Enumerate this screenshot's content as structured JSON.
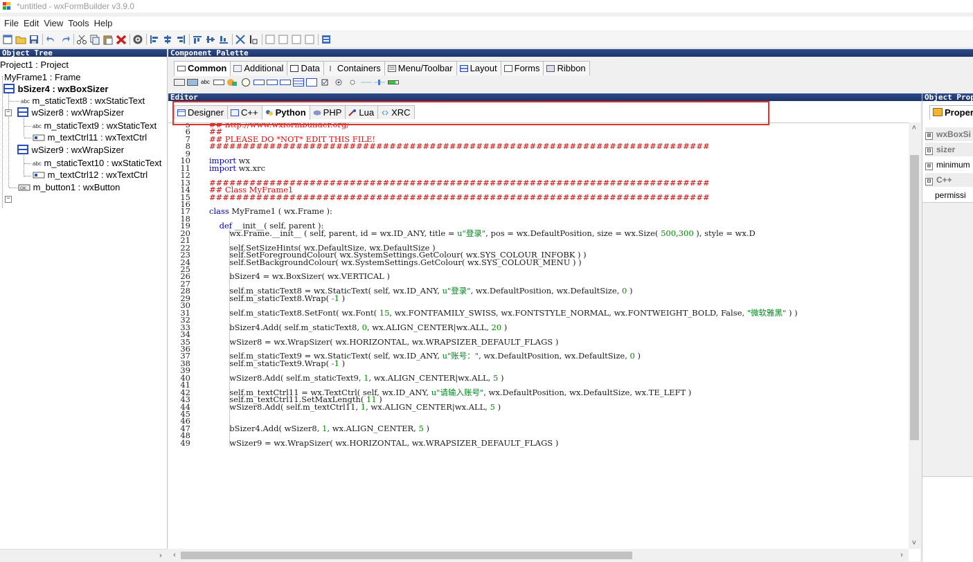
{
  "title": "*untitled - wxFormBuilder v3.9.0",
  "menu": [
    "File",
    "Edit",
    "View",
    "Tools",
    "Help"
  ],
  "object_tree": {
    "header": "Object Tree",
    "items": [
      {
        "label": "Project1 : Project"
      },
      {
        "label": "MyFrame1 : Frame"
      },
      {
        "label": "bSizer4 : wxBoxSizer",
        "bold": true
      },
      {
        "label": "m_staticText8 : wxStaticText"
      },
      {
        "label": "wSizer8 : wxWrapSizer"
      },
      {
        "label": "m_staticText9 : wxStaticText"
      },
      {
        "label": "m_textCtrl11 : wxTextCtrl"
      },
      {
        "label": "wSizer9 : wxWrapSizer"
      },
      {
        "label": "m_staticText10 : wxStaticText"
      },
      {
        "label": "m_textCtrl12 : wxTextCtrl"
      },
      {
        "label": "m_button1 : wxButton"
      }
    ]
  },
  "palette": {
    "header": "Component Palette",
    "tabs": [
      "Common",
      "Additional",
      "Data",
      "Containers",
      "Menu/Toolbar",
      "Layout",
      "Forms",
      "Ribbon"
    ],
    "active_tab": "Common"
  },
  "editor": {
    "header": "Editor",
    "tabs": [
      "Designer",
      "C++",
      "Python",
      "PHP",
      "Lua",
      "XRC"
    ],
    "active_tab": "Python",
    "lines": [
      {
        "n": "5",
        "t": "## http://www.wxformbuilder.org/",
        "c": "cm"
      },
      {
        "n": "6",
        "t": "##",
        "c": "cm"
      },
      {
        "n": "7",
        "t": "## PLEASE DO *NOT* EDIT THIS FILE!",
        "c": "cm"
      },
      {
        "n": "8",
        "t": "###########################################################################",
        "c": "cm"
      },
      {
        "n": "9",
        "t": ""
      },
      {
        "n": "10",
        "t": "import wx",
        "k": "import"
      },
      {
        "n": "11",
        "t": "import wx.xrc",
        "k": "import"
      },
      {
        "n": "12",
        "t": ""
      },
      {
        "n": "13",
        "t": "###########################################################################",
        "c": "cm"
      },
      {
        "n": "14",
        "t": "## Class MyFrame1",
        "c": "cm"
      },
      {
        "n": "15",
        "t": "###########################################################################",
        "c": "cm"
      },
      {
        "n": "16",
        "t": ""
      },
      {
        "n": "17",
        "t": "class MyFrame1 ( wx.Frame ):",
        "k": "class"
      },
      {
        "n": "18",
        "t": ""
      },
      {
        "n": "19",
        "t": "    def __init__( self, parent ):",
        "k": "def"
      },
      {
        "n": "20",
        "t": "        wx.Frame.__init__ ( self, parent, id = wx.ID_ANY, title = u\"登录\", pos = wx.DefaultPosition, size = wx.Size( 500,300 ), style = wx.D"
      },
      {
        "n": "21",
        "t": ""
      },
      {
        "n": "22",
        "t": "        self.SetSizeHints( wx.DefaultSize, wx.DefaultSize )"
      },
      {
        "n": "23",
        "t": "        self.SetForegroundColour( wx.SystemSettings.GetColour( wx.SYS_COLOUR_INFOBK ) )"
      },
      {
        "n": "24",
        "t": "        self.SetBackgroundColour( wx.SystemSettings.GetColour( wx.SYS_COLOUR_MENU ) )"
      },
      {
        "n": "25",
        "t": ""
      },
      {
        "n": "26",
        "t": "        bSizer4 = wx.BoxSizer( wx.VERTICAL )"
      },
      {
        "n": "27",
        "t": ""
      },
      {
        "n": "28",
        "t": "        self.m_staticText8 = wx.StaticText( self, wx.ID_ANY, u\"登录\", wx.DefaultPosition, wx.DefaultSize, 0 )"
      },
      {
        "n": "29",
        "t": "        self.m_staticText8.Wrap( -1 )"
      },
      {
        "n": "30",
        "t": ""
      },
      {
        "n": "31",
        "t": "        self.m_staticText8.SetFont( wx.Font( 15, wx.FONTFAMILY_SWISS, wx.FONTSTYLE_NORMAL, wx.FONTWEIGHT_BOLD, False, \"微软雅黑\" ) )"
      },
      {
        "n": "32",
        "t": ""
      },
      {
        "n": "33",
        "t": "        bSizer4.Add( self.m_staticText8, 0, wx.ALIGN_CENTER|wx.ALL, 20 )"
      },
      {
        "n": "34",
        "t": ""
      },
      {
        "n": "35",
        "t": "        wSizer8 = wx.WrapSizer( wx.HORIZONTAL, wx.WRAPSIZER_DEFAULT_FLAGS )"
      },
      {
        "n": "36",
        "t": ""
      },
      {
        "n": "37",
        "t": "        self.m_staticText9 = wx.StaticText( self, wx.ID_ANY, u\"账号：\", wx.DefaultPosition, wx.DefaultSize, 0 )"
      },
      {
        "n": "38",
        "t": "        self.m_staticText9.Wrap( -1 )"
      },
      {
        "n": "39",
        "t": ""
      },
      {
        "n": "40",
        "t": "        wSizer8.Add( self.m_staticText9, 1, wx.ALIGN_CENTER|wx.ALL, 5 )"
      },
      {
        "n": "41",
        "t": ""
      },
      {
        "n": "42",
        "t": "        self.m_textCtrl11 = wx.TextCtrl( self, wx.ID_ANY, u\"请输入账号\", wx.DefaultPosition, wx.DefaultSize, wx.TE_LEFT )"
      },
      {
        "n": "43",
        "t": "        self.m_textCtrl11.SetMaxLength( 11 )"
      },
      {
        "n": "44",
        "t": "        wSizer8.Add( self.m_textCtrl11, 1, wx.ALIGN_CENTER|wx.ALL, 5 )"
      },
      {
        "n": "45",
        "t": ""
      },
      {
        "n": "46",
        "t": ""
      },
      {
        "n": "47",
        "t": "        bSizer4.Add( wSizer8, 1, wx.ALIGN_CENTER, 5 )"
      },
      {
        "n": "48",
        "t": ""
      },
      {
        "n": "49",
        "t": "        wSizer9 = wx.WrapSizer( wx.HORIZONTAL, wx.WRAPSIZER_DEFAULT_FLAGS )"
      }
    ]
  },
  "properties": {
    "header": "Object Prop",
    "tab": "Propert",
    "rows": [
      {
        "label": "wxBoxSi",
        "category": true,
        "box": "⊞"
      },
      {
        "label": "sizer",
        "category": true,
        "box": "⊟"
      },
      {
        "label": "minimum",
        "category": false,
        "box": "⊞"
      },
      {
        "label": "C++",
        "category": true,
        "box": "⊟"
      },
      {
        "label": "permissi",
        "category": false,
        "box": ""
      }
    ]
  },
  "colors": {
    "header": "#1e3468",
    "highlight": "#e0332d",
    "keyword": "#0000b0",
    "comment": "#d01010",
    "string": "#00861f"
  }
}
